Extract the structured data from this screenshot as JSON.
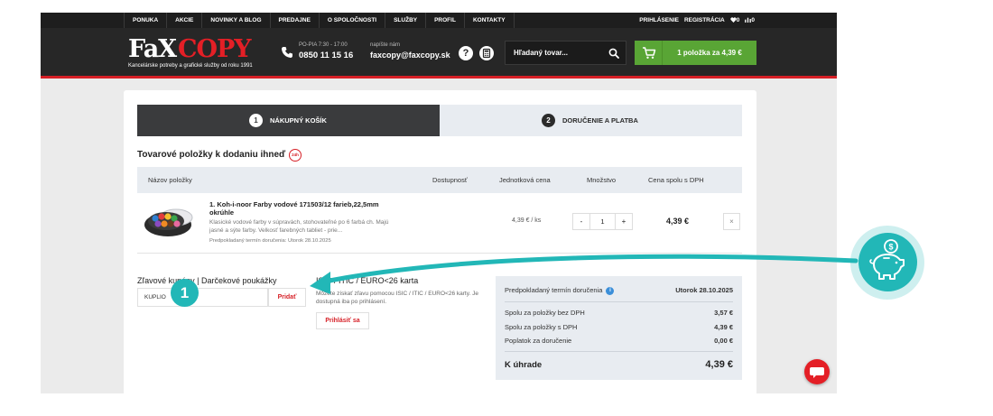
{
  "nav": {
    "items": [
      "PONUKA",
      "AKCIE",
      "NOVINKY A BLOG",
      "PREDAJNE",
      "O SPOLOČNOSTI",
      "SLUŽBY",
      "PROFIL",
      "KONTAKTY"
    ],
    "login": "PRIHLÁSENIE",
    "register": "REGISTRÁCIA",
    "wishlist_count": "0",
    "compare_count": "0"
  },
  "header": {
    "logo_fax": "FaX",
    "logo_copy": "COPY",
    "logo_tagline": "Kancelárske potreby a grafické služby od roku 1991",
    "hours": "PO-PIA 7:30 - 17:00",
    "phone": "0850 11 15 16",
    "mail_label": "napíšte nám",
    "email": "faxcopy@faxcopy.sk",
    "search_placeholder": "Hľadaný tovar...",
    "cart_label": "1 položka za 4,39 €"
  },
  "steps": [
    {
      "num": "1",
      "label": "NÁKUPNÝ KOŠÍK"
    },
    {
      "num": "2",
      "label": "DORUČENIE A PLATBA"
    }
  ],
  "section_title": "Tovarové položky k dodaniu ihneď",
  "badge_24h": "24h",
  "table": {
    "headers": [
      "Názov položky",
      "Dostupnosť",
      "Jednotková cena",
      "Množstvo",
      "Cena spolu s DPH"
    ],
    "row": {
      "name": "1. Koh-i-noor Farby vodové 171503/12 farieb,22,5mm okrúhle",
      "description": "Klasické vodové farby v súpravách, stohovateľné po 6 farbá ch. Majú jasné a sýte farby. Velkosť farebných tabliet - prie...",
      "delivery": "Predpokladaný termín doručenia: Utorok 28.10.2025",
      "unit_price": "4,39 € / ks",
      "qty_minus": "-",
      "quantity": "1",
      "qty_plus": "+",
      "total": "4,39 €",
      "remove": "×"
    }
  },
  "coupon": {
    "title": "Zľavové kupóny | Darčekové poukážky",
    "value": "KUPLIO",
    "button": "Pridať"
  },
  "isic": {
    "title": "ISIC / ITIC / EURO<26 karta",
    "text": "Môžete získať zľavu pomocou ISIC / ITIC / EURO<26 karty. Je dostupná iba po prihlásení.",
    "button": "Prihlásiť sa"
  },
  "summary": {
    "delivery_label": "Predpokladaný termín doručenia",
    "delivery_value": "Utorok 28.10.2025",
    "no_vat_label": "Spolu za položky bez DPH",
    "no_vat_value": "3,57 €",
    "vat_label": "Spolu za položky s DPH",
    "vat_value": "4,39 €",
    "shipping_label": "Poplatok za doručenie",
    "shipping_value": "0,00 €",
    "total_label": "K úhrade",
    "total_value": "4,39 €"
  },
  "overlay": {
    "callout_number": "1",
    "accent_color": "#22b7b7"
  },
  "colors": {
    "brand_red": "#d61f26",
    "cart_green": "#59a535",
    "dark": "#272727"
  }
}
